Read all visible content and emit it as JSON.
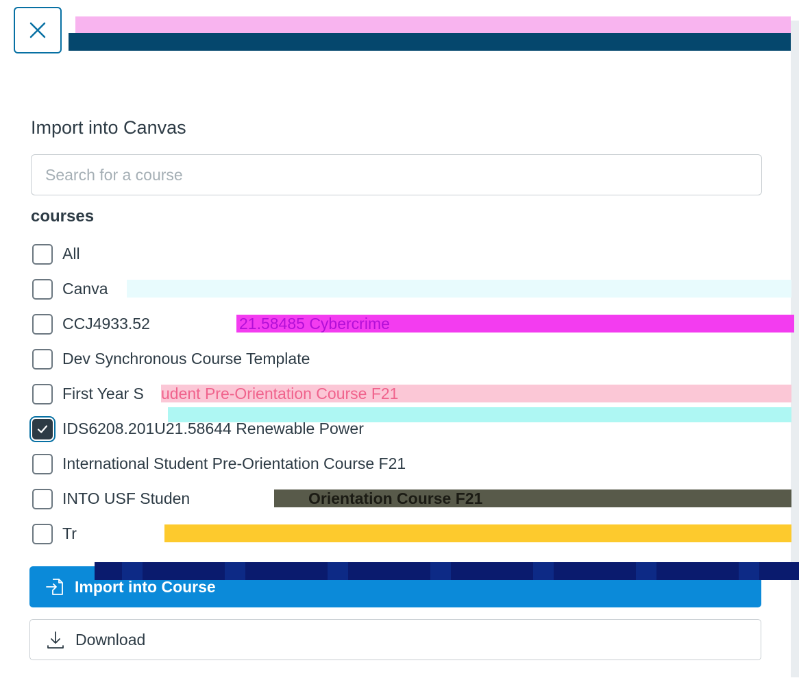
{
  "dialog": {
    "close_icon": "close-icon"
  },
  "import_panel": {
    "title": "Import into Canvas",
    "search": {
      "placeholder": "Search for a course",
      "value": ""
    },
    "group_label": "courses",
    "courses": [
      {
        "label": "All",
        "checked": false
      },
      {
        "label": "Canva",
        "checked": false
      },
      {
        "label": "CCJ4933.52",
        "checked": false
      },
      {
        "label": "Dev Synchronous Course Template",
        "checked": false
      },
      {
        "label": "First Year S",
        "checked": false
      },
      {
        "label": "IDS6208.201U21.58644 Renewable Power",
        "checked": true
      },
      {
        "label": "International Student Pre-Orientation Course F21",
        "checked": false
      },
      {
        "label": "INTO USF Studen",
        "checked": false
      },
      {
        "label": "Tr",
        "checked": false
      }
    ],
    "overlay_text": {
      "ccj_suffix": "21.58485 Cybercrime",
      "first_year_suffix": "udent Pre-Orientation Course F21",
      "into_suffix": "Orientation Course F21"
    }
  },
  "actions": {
    "import_label": "Import into Course",
    "import_icon": "import-file-icon",
    "download_label": "Download",
    "download_icon": "download-icon"
  },
  "colors": {
    "primary": "#0b8ad9",
    "focus": "#0770a3",
    "text": "#2d3b45"
  }
}
